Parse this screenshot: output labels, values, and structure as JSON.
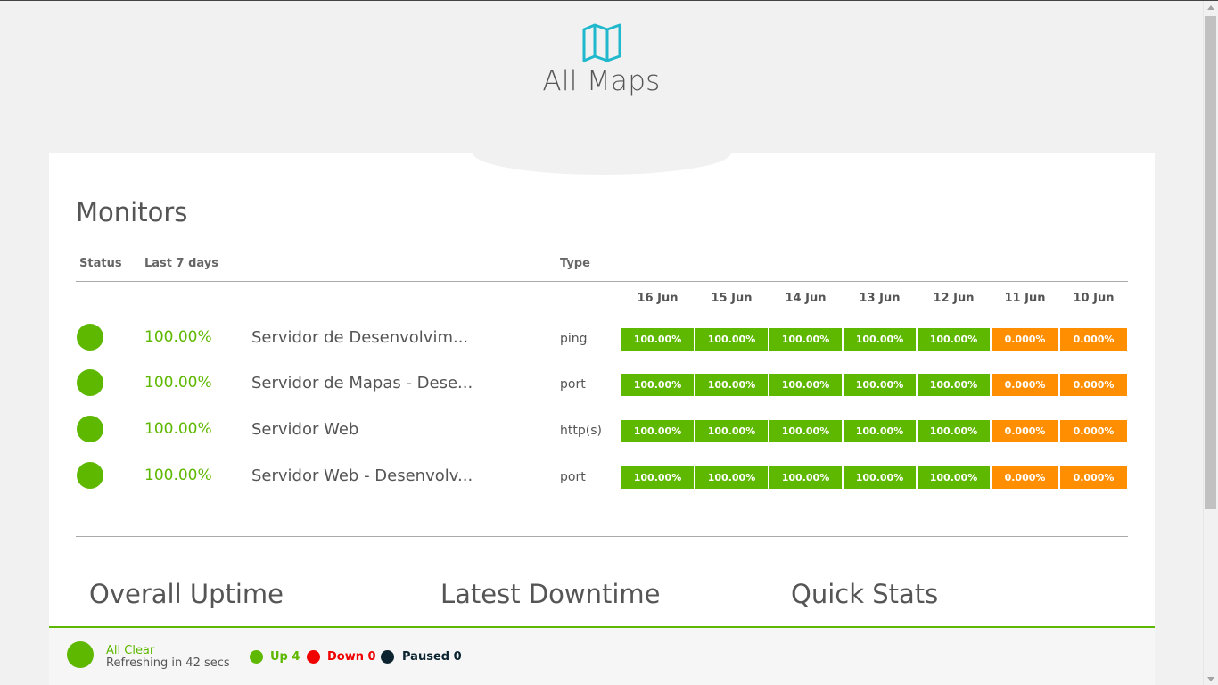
{
  "header": {
    "logo_icon": "map-icon",
    "title": "All Maps"
  },
  "monitors": {
    "title": "Monitors",
    "columns": {
      "status": "Status",
      "last7": "Last 7 days",
      "type": "Type"
    },
    "days": [
      "16 Jun",
      "15 Jun",
      "14 Jun",
      "13 Jun",
      "12 Jun",
      "11 Jun",
      "10 Jun"
    ],
    "rows": [
      {
        "uptime": "100.00%",
        "name": "Servidor de Desenvolvim...",
        "type": "ping",
        "daily": [
          "100.00%",
          "100.00%",
          "100.00%",
          "100.00%",
          "100.00%",
          "0.000%",
          "0.000%"
        ]
      },
      {
        "uptime": "100.00%",
        "name": "Servidor de Mapas - Dese...",
        "type": "port",
        "daily": [
          "100.00%",
          "100.00%",
          "100.00%",
          "100.00%",
          "100.00%",
          "0.000%",
          "0.000%"
        ]
      },
      {
        "uptime": "100.00%",
        "name": "Servidor Web",
        "type": "http(s)",
        "daily": [
          "100.00%",
          "100.00%",
          "100.00%",
          "100.00%",
          "100.00%",
          "0.000%",
          "0.000%"
        ]
      },
      {
        "uptime": "100.00%",
        "name": "Servidor Web - Desenvolv...",
        "type": "port",
        "daily": [
          "100.00%",
          "100.00%",
          "100.00%",
          "100.00%",
          "100.00%",
          "0.000%",
          "0.000%"
        ]
      }
    ]
  },
  "sections": {
    "overall": "Overall Uptime",
    "downtime": "Latest Downtime",
    "stats": "Quick Stats"
  },
  "footer": {
    "status": "All Clear",
    "refresh": "Refreshing in 42 secs",
    "up": "Up 4",
    "down": "Down 0",
    "paused": "Paused 0"
  },
  "colors": {
    "up": "#5fb800",
    "partial": "#ff8f00",
    "down": "#f00000",
    "paused": "#0c2430",
    "logo": "#1fb8cc"
  }
}
